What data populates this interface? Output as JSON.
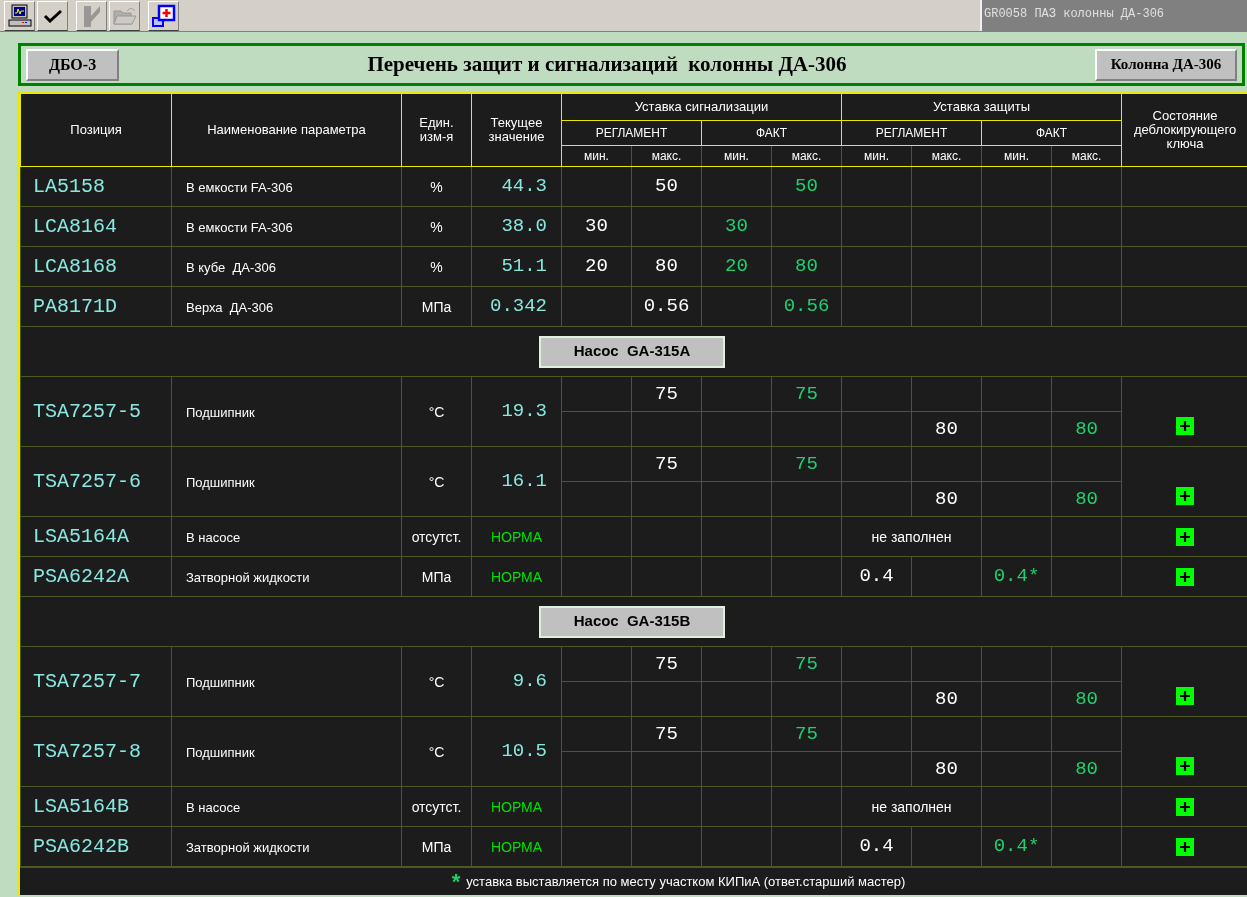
{
  "toolbar": {
    "buttons": [
      {
        "kind": "monitor",
        "disabled": false
      },
      {
        "kind": "check",
        "disabled": false
      },
      {
        "kind": "tool",
        "disabled": true
      },
      {
        "kind": "folder",
        "disabled": true
      },
      {
        "kind": "window-plus",
        "disabled": false
      }
    ],
    "display_id": "GR0058 ПАЗ колонны ДА-306"
  },
  "header": {
    "left_button": "ДБО-3",
    "title": "Перечень защит и сигнализаций  колонны ДА-306",
    "right_button": "Колонна ДА-306"
  },
  "table": {
    "columns": [
      "Позиция",
      "Наименование параметра",
      "Един. изм-я",
      "Текущее значение"
    ],
    "groups": [
      {
        "label": "Уставка сигнализации",
        "subgroups": [
          {
            "label": "РЕГЛАМЕНТ",
            "cols": [
              "мин.",
              "макс."
            ]
          },
          {
            "label": "ФАКТ",
            "cols": [
              "мин.",
              "макс."
            ]
          }
        ]
      },
      {
        "label": "Уставка защиты",
        "subgroups": [
          {
            "label": "РЕГЛАМЕНТ",
            "cols": [
              "мин.",
              "макс."
            ]
          },
          {
            "label": "ФАКТ",
            "cols": [
              "мин.",
              "макс."
            ]
          }
        ]
      }
    ],
    "key_column": "Состояние деблокирующего ключа",
    "rows": [
      {
        "kind": "single",
        "position": "LA5158",
        "name": "В емкости FA-306",
        "unit": "%",
        "value": "44.3",
        "alarm": {
          "reg_max": "50",
          "fact_max": "50"
        },
        "unlock_key": false
      },
      {
        "kind": "single",
        "position": "LCA8164",
        "name": "В емкости FA-306",
        "unit": "%",
        "value": "38.0",
        "alarm": {
          "reg_min": "30",
          "fact_min": "30"
        },
        "unlock_key": false
      },
      {
        "kind": "single",
        "position": "LCA8168",
        "name": "В кубе  ДА-306",
        "unit": "%",
        "value": "51.1",
        "alarm": {
          "reg_min": "20",
          "reg_max": "80",
          "fact_min": "20",
          "fact_max": "80"
        },
        "unlock_key": false
      },
      {
        "kind": "single",
        "position": "PA8171D",
        "name": "Верха  ДА-306",
        "unit": "МПа",
        "value": "0.342",
        "alarm": {
          "reg_max": "0.56",
          "fact_max": "0.56"
        },
        "unlock_key": false
      },
      {
        "kind": "section",
        "label": "Насос  GA-315A"
      },
      {
        "kind": "double",
        "position": "TSA7257-5",
        "name": "Подшипник",
        "unit": "°C",
        "value": "19.3",
        "alarm": {
          "reg_max": "75",
          "fact_max": "75"
        },
        "protection": {
          "reg_max": "80",
          "fact_max": "80"
        },
        "unlock_key": true
      },
      {
        "kind": "double",
        "position": "TSA7257-6",
        "name": "Подшипник",
        "unit": "°C",
        "value": "16.1",
        "alarm": {
          "reg_max": "75",
          "fact_max": "75"
        },
        "protection": {
          "reg_max": "80",
          "fact_max": "80"
        },
        "unlock_key": true
      },
      {
        "kind": "note",
        "position": "LSA5164A",
        "name": "В насосе",
        "unit": "отсутст.",
        "value": "НОРМА",
        "status_value": true,
        "note": "не заполнен",
        "unlock_key": true
      },
      {
        "kind": "single",
        "position": "PSA6242A",
        "name": "Затворной жидкости",
        "unit": "МПа",
        "value": "НОРМА",
        "status_value": true,
        "protection": {
          "reg_min": "0.4",
          "fact_min": "0.4*"
        },
        "unlock_key": true
      },
      {
        "kind": "section",
        "label": "Насос  GA-315B"
      },
      {
        "kind": "double",
        "position": "TSA7257-7",
        "name": "Подшипник",
        "unit": "°C",
        "value": "9.6",
        "alarm": {
          "reg_max": "75",
          "fact_max": "75"
        },
        "protection": {
          "reg_max": "80",
          "fact_max": "80"
        },
        "unlock_key": true
      },
      {
        "kind": "double",
        "position": "TSA7257-8",
        "name": "Подшипник",
        "unit": "°C",
        "value": "10.5",
        "alarm": {
          "reg_max": "75",
          "fact_max": "75"
        },
        "protection": {
          "reg_max": "80",
          "fact_max": "80"
        },
        "unlock_key": true
      },
      {
        "kind": "note",
        "position": "LSA5164B",
        "name": "В насосе",
        "unit": "отсутст.",
        "value": "НОРМА",
        "status_value": true,
        "note": "не заполнен",
        "unlock_key": true
      },
      {
        "kind": "single",
        "position": "PSA6242B",
        "name": "Затворной жидкости",
        "unit": "МПа",
        "value": "НОРМА",
        "status_value": true,
        "protection": {
          "reg_min": "0.4",
          "fact_min": "0.4*"
        },
        "unlock_key": true
      }
    ]
  },
  "footnote": {
    "mark": "*",
    "text": "уставка выставляется по месту участком КИПиА (ответ.старший мастер)"
  }
}
